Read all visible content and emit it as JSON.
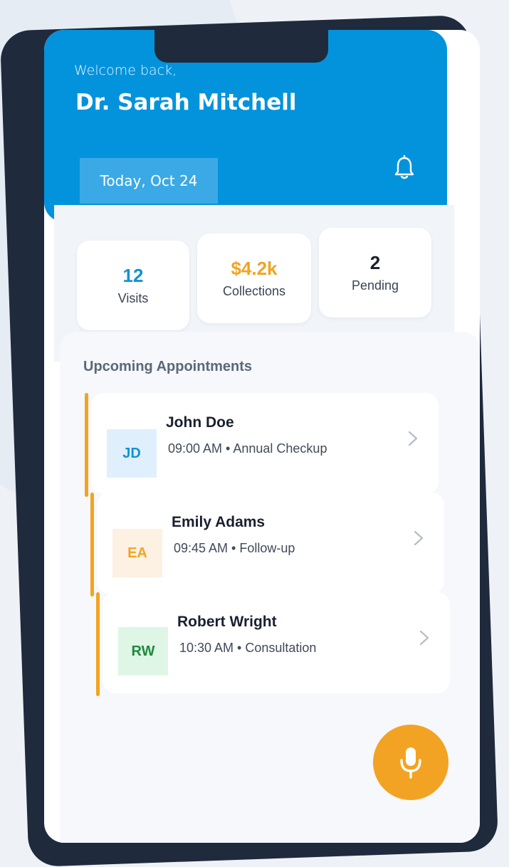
{
  "header": {
    "greeting": "Welcome back,",
    "doctor_name": "Dr. Sarah Mitchell",
    "date_label": "Today, Oct 24",
    "bell_icon": "bell-icon"
  },
  "stats": [
    {
      "value": "12",
      "label": "Visits",
      "color": "#1291d6"
    },
    {
      "value": "$4.2k",
      "label": "Collections",
      "color": "#f3a323"
    },
    {
      "value": "2",
      "label": "Pending",
      "color": "#1a2030"
    }
  ],
  "appointments_section": {
    "title": "Upcoming Appointments",
    "items": [
      {
        "initials": "JD",
        "name": "John Doe",
        "time_detail": "09:00 AM • Annual Checkup",
        "avatar_bg": "#dff0fc",
        "avatar_color": "#1291d6"
      },
      {
        "initials": "EA",
        "name": "Emily Adams",
        "time_detail": "09:45 AM • Follow-up",
        "avatar_bg": "#fdf1e4",
        "avatar_color": "#f3a323"
      },
      {
        "initials": "RW",
        "name": "Robert Wright",
        "time_detail": "10:30 AM • Consultation",
        "avatar_bg": "#dff6e6",
        "avatar_color": "#1d8a3c"
      }
    ]
  },
  "fab": {
    "icon": "microphone-icon"
  },
  "colors": {
    "primary": "#0393dc",
    "accent": "#f3a323",
    "frame": "#1f2a3c"
  }
}
